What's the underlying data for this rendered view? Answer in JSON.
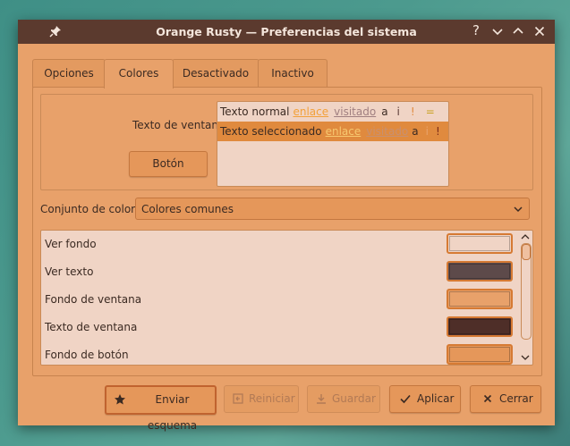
{
  "window": {
    "title": "Orange Rusty — Preferencias del sistema",
    "help_glyph": "?"
  },
  "tabs": [
    {
      "label": "Opciones",
      "active": false
    },
    {
      "label": "Colores",
      "active": true
    },
    {
      "label": "Desactivado",
      "active": false
    },
    {
      "label": "Inactivo",
      "active": false
    }
  ],
  "preview": {
    "window_text_label": "Texto de ventana",
    "button_label": "Botón",
    "normal_row": {
      "text": "Texto normal",
      "link": "enlace",
      "visited": "visitado",
      "a": "a",
      "i": "i",
      "excl": "!",
      "eq": "=",
      "plus": "+"
    },
    "selected_row": {
      "text": "Texto seleccionado",
      "link": "enlace",
      "visited": "visitado",
      "a": "a",
      "i": "i",
      "excl": "!",
      "eq": "=",
      "plus": "+"
    }
  },
  "scheme": {
    "label": "Conjunto de color:",
    "selected": "Colores comunes"
  },
  "color_list": [
    {
      "name": "Ver fondo",
      "color": "#f0d4c5"
    },
    {
      "name": "Ver texto",
      "color": "#5d4a4a"
    },
    {
      "name": "Fondo de ventana",
      "color": "#e8a16a"
    },
    {
      "name": "Texto de ventana",
      "color": "#4e2e28"
    },
    {
      "name": "Fondo de botón",
      "color": "#e5975a"
    }
  ],
  "buttons": {
    "send_scheme": "Enviar esquema",
    "reset": "Reiniciar",
    "save": "Guardar",
    "apply": "Aplicar",
    "close": "Cerrar"
  },
  "colors": {
    "titlebar": "#5b3a2e",
    "window_bg": "#e8a16a",
    "view_bg": "#f0d4c5",
    "selection": "#e08a3e",
    "link": "#f2a13a",
    "visited": "#a07f80"
  }
}
